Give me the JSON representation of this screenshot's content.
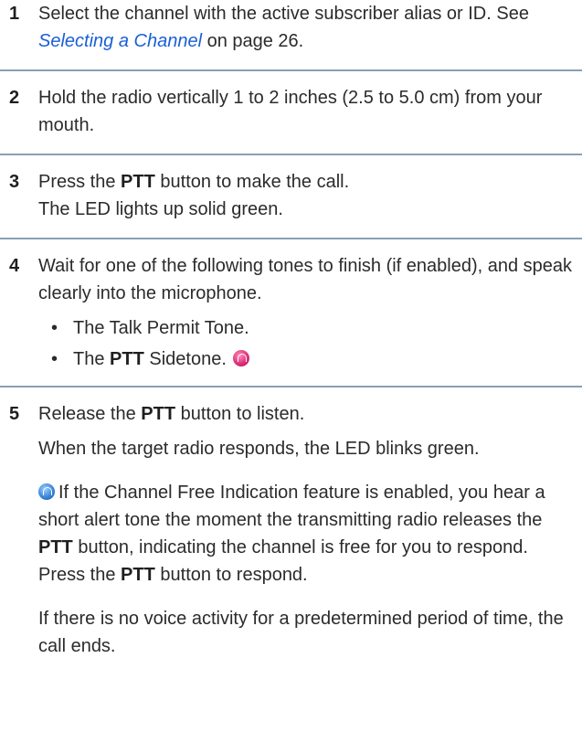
{
  "steps": [
    {
      "number": "1",
      "text_before": "Select the channel with the active subscriber alias or ID. See ",
      "link": "Selecting a Channel",
      "text_after": " on page 26."
    },
    {
      "number": "2",
      "text": "Hold the radio vertically 1 to 2 inches (2.5 to 5.0 cm) from your mouth."
    },
    {
      "number": "3",
      "line1_before": "Press the ",
      "line1_bold": "PTT",
      "line1_after": " button to make the call.",
      "line2": "The LED lights up solid green."
    },
    {
      "number": "4",
      "text": "Wait for one of the following tones to finish (if enabled), and speak clearly into the microphone.",
      "bullet_char": "•",
      "bullet1": "The Talk Permit Tone.",
      "bullet2_before": "The ",
      "bullet2_bold": "PTT",
      "bullet2_after": " Sidetone."
    },
    {
      "number": "5",
      "line1_before": "Release the ",
      "line1_bold": "PTT",
      "line1_after": " button to listen.",
      "para1": "When the target radio responds, the LED blinks green.",
      "para2_a": "If the Channel Free Indication feature is enabled, you hear a short alert tone the moment the transmitting radio releases the ",
      "para2_bold1": "PTT",
      "para2_b": " button, indicating the channel is free for you to respond. Press the ",
      "para2_bold2": "PTT",
      "para2_c": " button to respond.",
      "para3": "If there is no voice activity for a predetermined period of time, the call ends."
    }
  ],
  "icons": {
    "sidetone": "pink-tone-icon",
    "channel_free": "blue-tone-icon"
  },
  "colors": {
    "link": "#1a5fd6",
    "separator": "#8a9fb4",
    "icon_pink": "#e0307a",
    "icon_blue": "#3a86d8"
  }
}
